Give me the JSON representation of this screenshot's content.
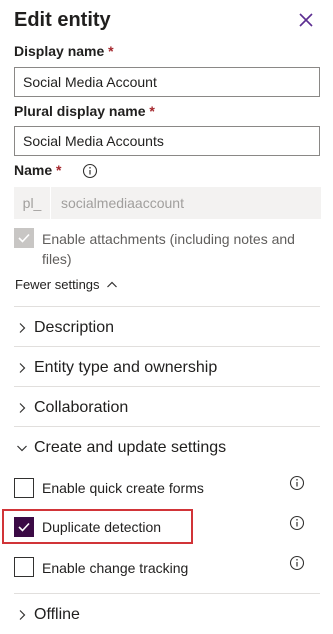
{
  "panel": {
    "title": "Edit entity",
    "close_icon": "close-icon"
  },
  "form": {
    "display_name": {
      "label": "Display name",
      "required_mark": "*",
      "value": "Social Media Account"
    },
    "plural_display_name": {
      "label": "Plural display name",
      "required_mark": "*",
      "value": "Social Media Accounts"
    },
    "name": {
      "label": "Name",
      "required_mark": "*",
      "prefix": "pl_",
      "value": "socialmediaaccount",
      "info_icon": "info-icon"
    },
    "enable_attachments": {
      "label_line1": "Enable attachments (including notes and",
      "label_line2": "files)",
      "checked": true,
      "disabled": true
    },
    "fewer_settings": {
      "label": "Fewer settings",
      "icon": "chevron-up-icon"
    }
  },
  "sections": [
    {
      "label": "Description",
      "expanded": false
    },
    {
      "label": "Entity type and ownership",
      "expanded": false
    },
    {
      "label": "Collaboration",
      "expanded": false
    },
    {
      "label": "Create and update settings",
      "expanded": true
    },
    {
      "label": "Offline",
      "expanded": false
    }
  ],
  "create_update_options": [
    {
      "label": "Enable quick create forms",
      "checked": false
    },
    {
      "label": "Duplicate detection",
      "checked": true,
      "highlighted": true
    },
    {
      "label": "Enable change tracking",
      "checked": false
    }
  ],
  "colors": {
    "accent": "#3b0a45",
    "highlight": "#d13438",
    "required": "#a4262c"
  }
}
